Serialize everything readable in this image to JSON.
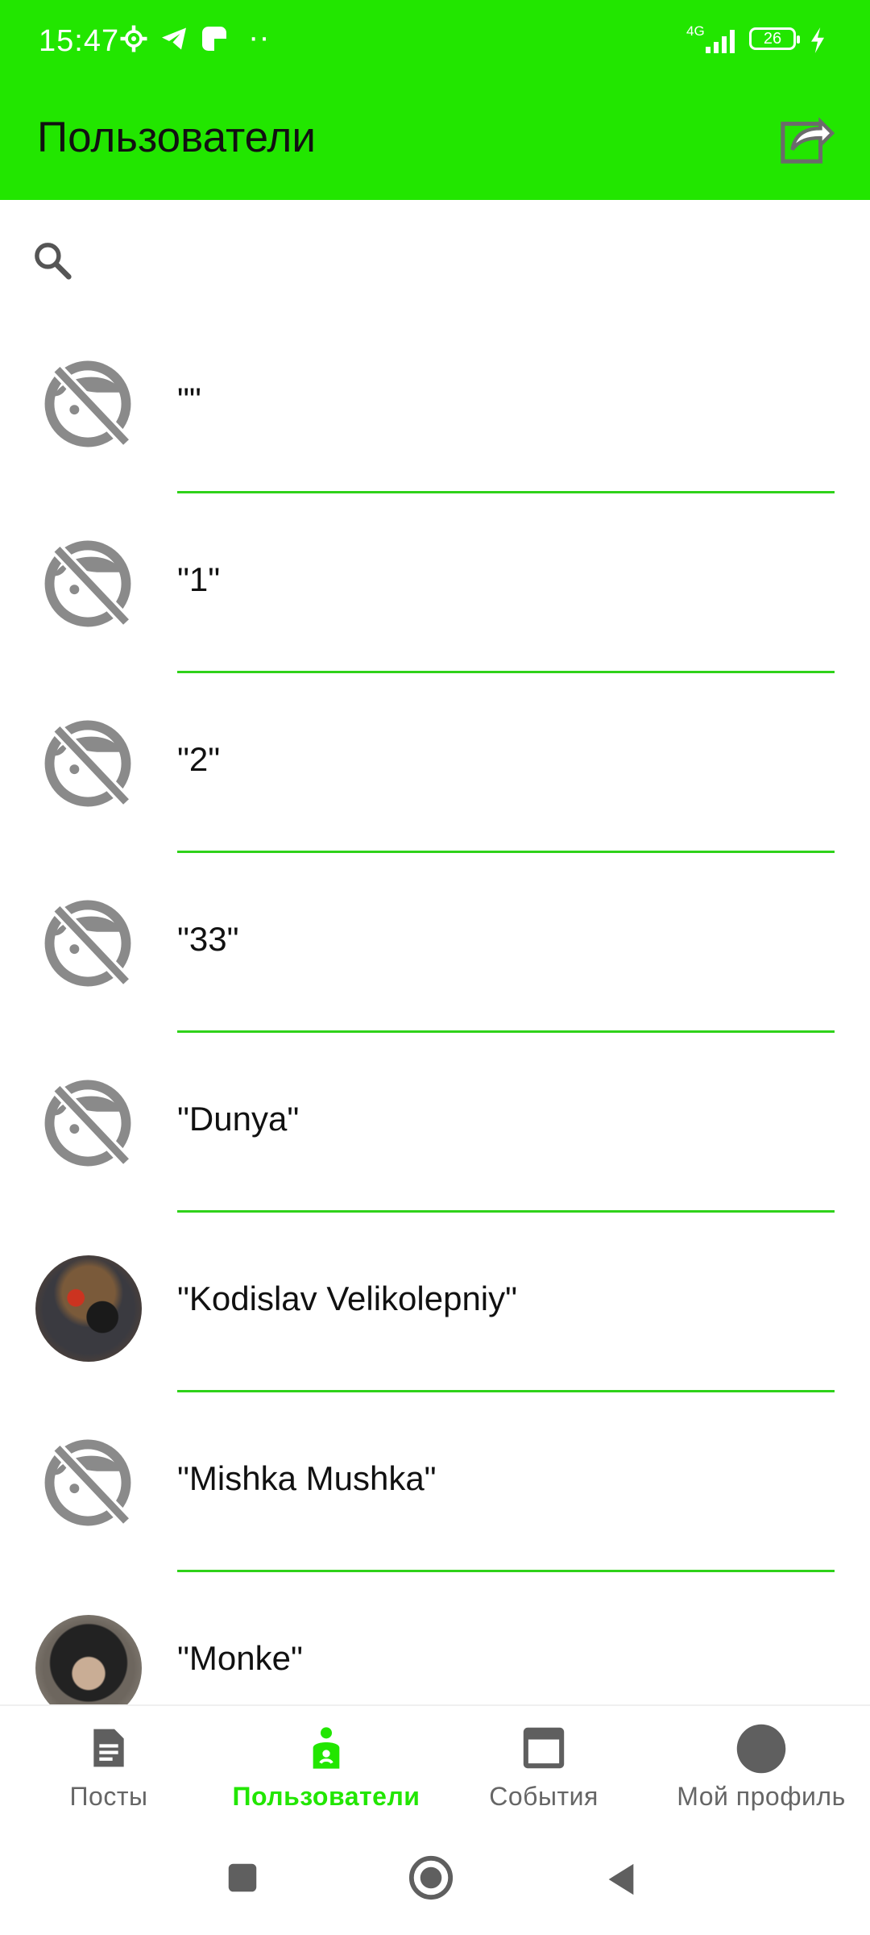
{
  "status_bar": {
    "time": "15:47",
    "network": "4G",
    "battery": "26",
    "dots": "··"
  },
  "app_bar": {
    "title": "Пользователи"
  },
  "users": [
    {
      "name": "\"\"",
      "avatar": "placeholder"
    },
    {
      "name": "\"1\"",
      "avatar": "placeholder"
    },
    {
      "name": "\"2\"",
      "avatar": "placeholder"
    },
    {
      "name": "\"33\"",
      "avatar": "placeholder"
    },
    {
      "name": "\"Dunya\"",
      "avatar": "placeholder"
    },
    {
      "name": "\"Kodislav Velikolepniy\"",
      "avatar": "photo-dog"
    },
    {
      "name": "\"Mishka Mushka\"",
      "avatar": "placeholder"
    },
    {
      "name": "\"Monke\"",
      "avatar": "photo-monkey"
    }
  ],
  "bottom_nav": {
    "items": [
      {
        "label": "Посты",
        "icon": "document-icon",
        "active": false
      },
      {
        "label": "Пользователи",
        "icon": "user-icon",
        "active": true
      },
      {
        "label": "События",
        "icon": "window-icon",
        "active": false
      },
      {
        "label": "Мой профиль",
        "icon": "profile-avatar-icon",
        "active": false
      }
    ]
  },
  "colors": {
    "primary": "#22e600",
    "divider": "#2fd21a",
    "icon_gray": "#8a8a8a"
  }
}
